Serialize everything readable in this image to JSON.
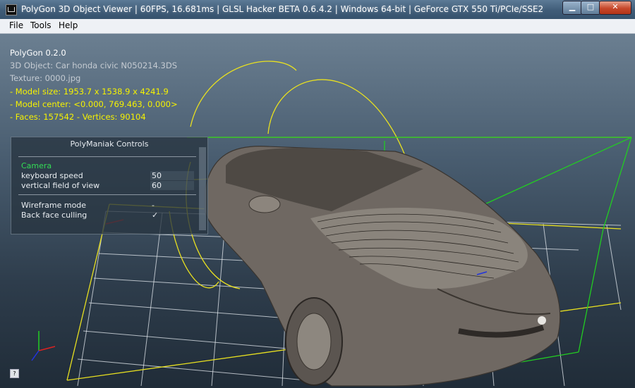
{
  "window": {
    "title": "PolyGon 3D Object Viewer | 60FPS, 16.681ms | GLSL Hacker BETA 0.6.4.2 | Windows 64-bit | GeForce GTX 550 Ti/PCIe/SSE2",
    "minimize_glyph": "▁",
    "maximize_glyph": "□",
    "close_glyph": "✕"
  },
  "menu": [
    "File",
    "Tools",
    "Help"
  ],
  "info": {
    "app_version": "PolyGon 0.2.0",
    "object": "3D Object: Car honda civic N050214.3DS",
    "texture": "Texture: 0000.jpg",
    "model_size": "- Model size:  1953.7 x 1538.9 x 4241.9",
    "model_center": "- Model center:  <0.000, 769.463, 0.000>",
    "faces_vertices": "- Faces: 157542 - Vertices: 90104"
  },
  "controls_panel": {
    "title": "PolyManiak Controls",
    "section": "Camera",
    "keyboard_speed_label": "keyboard speed",
    "keyboard_speed_value": "50",
    "fov_label": "vertical field of view",
    "fov_value": "60",
    "wireframe_label": "Wireframe mode",
    "wireframe_value": "-",
    "backface_label": "Back face culling",
    "backface_value": "✓"
  },
  "help_button": "?",
  "colors": {
    "info_yellow": "#f6f200",
    "panel_green": "#33dd55",
    "bbox_green": "#22cc22",
    "bbox_yellow": "#e8e020"
  }
}
